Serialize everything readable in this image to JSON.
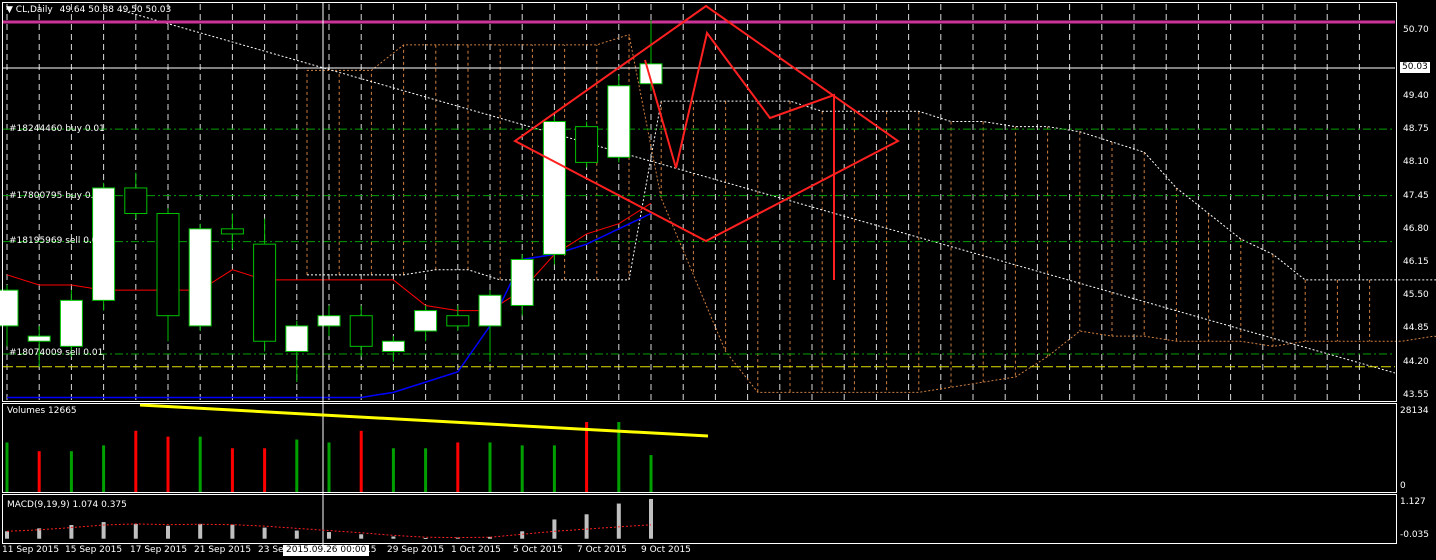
{
  "header": {
    "symbol_label": "CL,Daily",
    "ohlc": "49.64 50.88 49.50 50.03"
  },
  "price_axis": {
    "ticks": [
      "50.70",
      "49.40",
      "48.75",
      "48.10",
      "47.45",
      "46.80",
      "46.15",
      "45.50",
      "44.85",
      "44.20",
      "43.55"
    ],
    "current_price": "50.03"
  },
  "orders": [
    {
      "label": "#18244460 buy 0.01"
    },
    {
      "label": "#17800795 buy 0.01"
    },
    {
      "label": "#18195969 sell 0.0"
    },
    {
      "label": "#18074009 sell 0.01"
    }
  ],
  "volumes_pane": {
    "title": "Volumes 12665",
    "max_label": "28134",
    "min_label": "0"
  },
  "macd_pane": {
    "title": "MACD(9,19,9) 1.074 0.375",
    "max_label": "1.127",
    "zero_label": "-0.035"
  },
  "time_axis": {
    "labels": [
      "11 Sep 2015",
      "15 Sep 2015",
      "17 Sep 2015",
      "21 Sep 2015",
      "23 Sep",
      "2015.09.26 00:00",
      "15",
      "29 Sep 2015",
      "1 Oct 2015",
      "5 Oct 2015",
      "7 Oct 2015",
      "9 Oct 2015"
    ]
  },
  "colors": {
    "background": "#000000",
    "bull_candle": "#ffffff",
    "bear_candle": "#000000",
    "candle_outline": "#00c000",
    "resistance_line": "#cc3399",
    "tenkan": "#ff0000",
    "kijun": "#0000ff",
    "volume_up": "#00a000",
    "volume_down": "#ff0000",
    "trend_yellow": "#ffff00",
    "drawing_red": "#ff2020",
    "order_line": "#00a000",
    "level_yellow": "#e0e000"
  },
  "chart_data": {
    "type": "candlestick",
    "candles": [
      {
        "date": "2015-09-10",
        "open": 44.9,
        "high": 45.7,
        "low": 44.5,
        "close": 45.6
      },
      {
        "date": "2015-09-11",
        "open": 44.6,
        "high": 44.9,
        "low": 44.1,
        "close": 44.7
      },
      {
        "date": "2015-09-14",
        "open": 44.5,
        "high": 45.6,
        "low": 44.3,
        "close": 45.4
      },
      {
        "date": "2015-09-15",
        "open": 45.4,
        "high": 47.7,
        "low": 45.2,
        "close": 47.6
      },
      {
        "date": "2015-09-16",
        "open": 47.6,
        "high": 47.9,
        "low": 47.0,
        "close": 47.1
      },
      {
        "date": "2015-09-17",
        "open": 47.1,
        "high": 47.2,
        "low": 44.6,
        "close": 45.1
      },
      {
        "date": "2015-09-18",
        "open": 44.9,
        "high": 46.9,
        "low": 44.8,
        "close": 46.8
      },
      {
        "date": "2015-09-21",
        "open": 46.8,
        "high": 47.1,
        "low": 46.4,
        "close": 46.7
      },
      {
        "date": "2015-09-22",
        "open": 46.5,
        "high": 47.0,
        "low": 44.4,
        "close": 44.6
      },
      {
        "date": "2015-09-23",
        "open": 44.4,
        "high": 45.0,
        "low": 43.8,
        "close": 44.9
      },
      {
        "date": "2015-09-24",
        "open": 44.9,
        "high": 45.3,
        "low": 44.7,
        "close": 45.1
      },
      {
        "date": "2015-09-25",
        "open": 45.1,
        "high": 45.3,
        "low": 44.3,
        "close": 44.5
      },
      {
        "date": "2015-09-28",
        "open": 44.4,
        "high": 44.7,
        "low": 44.2,
        "close": 44.6
      },
      {
        "date": "2015-09-29",
        "open": 44.8,
        "high": 45.3,
        "low": 44.6,
        "close": 45.2
      },
      {
        "date": "2015-09-30",
        "open": 45.1,
        "high": 45.3,
        "low": 44.8,
        "close": 44.9
      },
      {
        "date": "2015-10-01",
        "open": 44.9,
        "high": 45.6,
        "low": 44.2,
        "close": 45.5
      },
      {
        "date": "2015-10-02",
        "open": 45.3,
        "high": 46.3,
        "low": 45.1,
        "close": 46.2
      },
      {
        "date": "2015-10-05",
        "open": 46.3,
        "high": 49.0,
        "low": 46.1,
        "close": 48.9
      },
      {
        "date": "2015-10-06",
        "open": 48.8,
        "high": 48.9,
        "low": 48.0,
        "close": 48.1
      },
      {
        "date": "2015-10-07",
        "open": 48.2,
        "high": 49.8,
        "low": 48.1,
        "close": 49.6
      },
      {
        "date": "2015-10-08",
        "open": 49.64,
        "high": 50.88,
        "low": 49.5,
        "close": 50.03
      }
    ],
    "volumes": [
      17000,
      14000,
      14000,
      16000,
      21000,
      19000,
      19000,
      15000,
      15000,
      18000,
      17000,
      21000,
      15000,
      15000,
      17000,
      17000,
      16000,
      16000,
      24000,
      24000,
      12665
    ],
    "macd": {
      "histogram": [
        0.2,
        0.28,
        0.37,
        0.45,
        0.4,
        0.35,
        0.4,
        0.38,
        0.3,
        0.22,
        0.18,
        0.12,
        0.06,
        0.02,
        0.03,
        0.05,
        0.2,
        0.52,
        0.66,
        0.95,
        1.074
      ],
      "signal": [
        0.2,
        0.24,
        0.3,
        0.37,
        0.4,
        0.38,
        0.39,
        0.38,
        0.34,
        0.28,
        0.22,
        0.16,
        0.09,
        0.04,
        0.03,
        0.04,
        0.12,
        0.2,
        0.26,
        0.32,
        0.375
      ]
    },
    "tenkan": [
      45.9,
      45.7,
      45.7,
      45.6,
      45.6,
      45.6,
      45.6,
      46.0,
      45.8,
      45.8,
      45.8,
      45.8,
      45.8,
      45.3,
      45.2,
      45.2,
      45.6,
      46.3,
      46.7,
      46.9,
      47.3
    ],
    "kijun": [
      43.5,
      43.5,
      43.5,
      43.5,
      43.5,
      43.5,
      43.5,
      43.5,
      43.5,
      43.5,
      43.5,
      43.5,
      43.6,
      43.8,
      44.0,
      44.9,
      46.2,
      46.3,
      46.5,
      46.8,
      47.1
    ],
    "levels": [
      {
        "name": "resistance",
        "price": 51.0
      },
      {
        "name": "order-18244460",
        "price": 48.75
      },
      {
        "name": "order-17800795",
        "price": 47.45
      },
      {
        "name": "order-18195969",
        "price": 46.55
      },
      {
        "name": "order-18074009",
        "price": 44.35
      },
      {
        "name": "yellow-level",
        "price": 44.1
      }
    ],
    "y_range": [
      43.45,
      51.2
    ]
  }
}
